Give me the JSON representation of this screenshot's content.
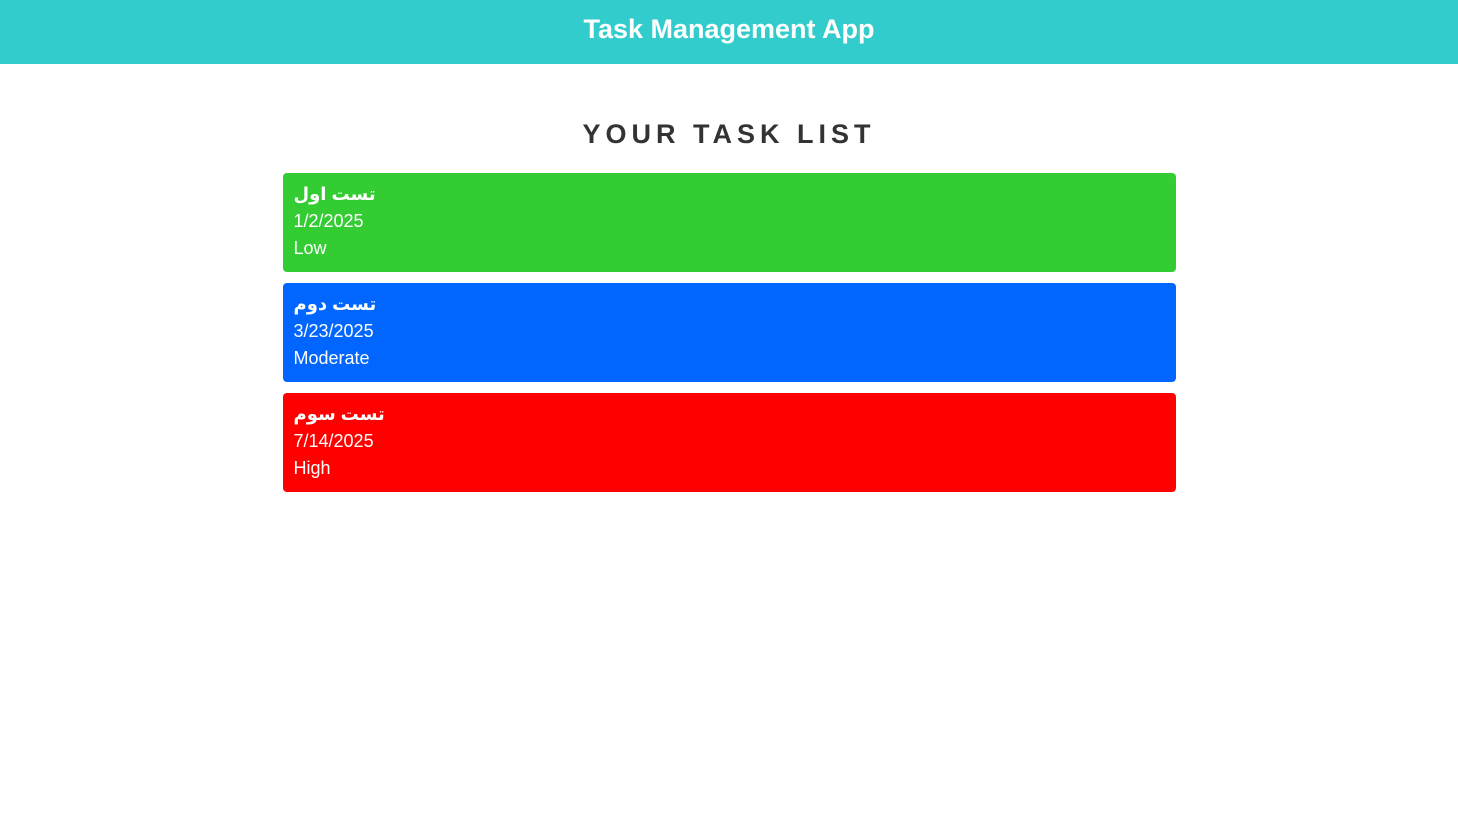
{
  "header": {
    "title": "Task Management App",
    "background_color": "#33cccc"
  },
  "main": {
    "heading": "YOUR TASK LIST",
    "tasks": [
      {
        "title": "تست اول",
        "date": "1/2/2025",
        "priority": "Low",
        "color": "#33cc33"
      },
      {
        "title": "تست دوم",
        "date": "3/23/2025",
        "priority": "Moderate",
        "color": "#0066ff"
      },
      {
        "title": "تست سوم",
        "date": "7/14/2025",
        "priority": "High",
        "color": "#ff0000"
      }
    ]
  }
}
